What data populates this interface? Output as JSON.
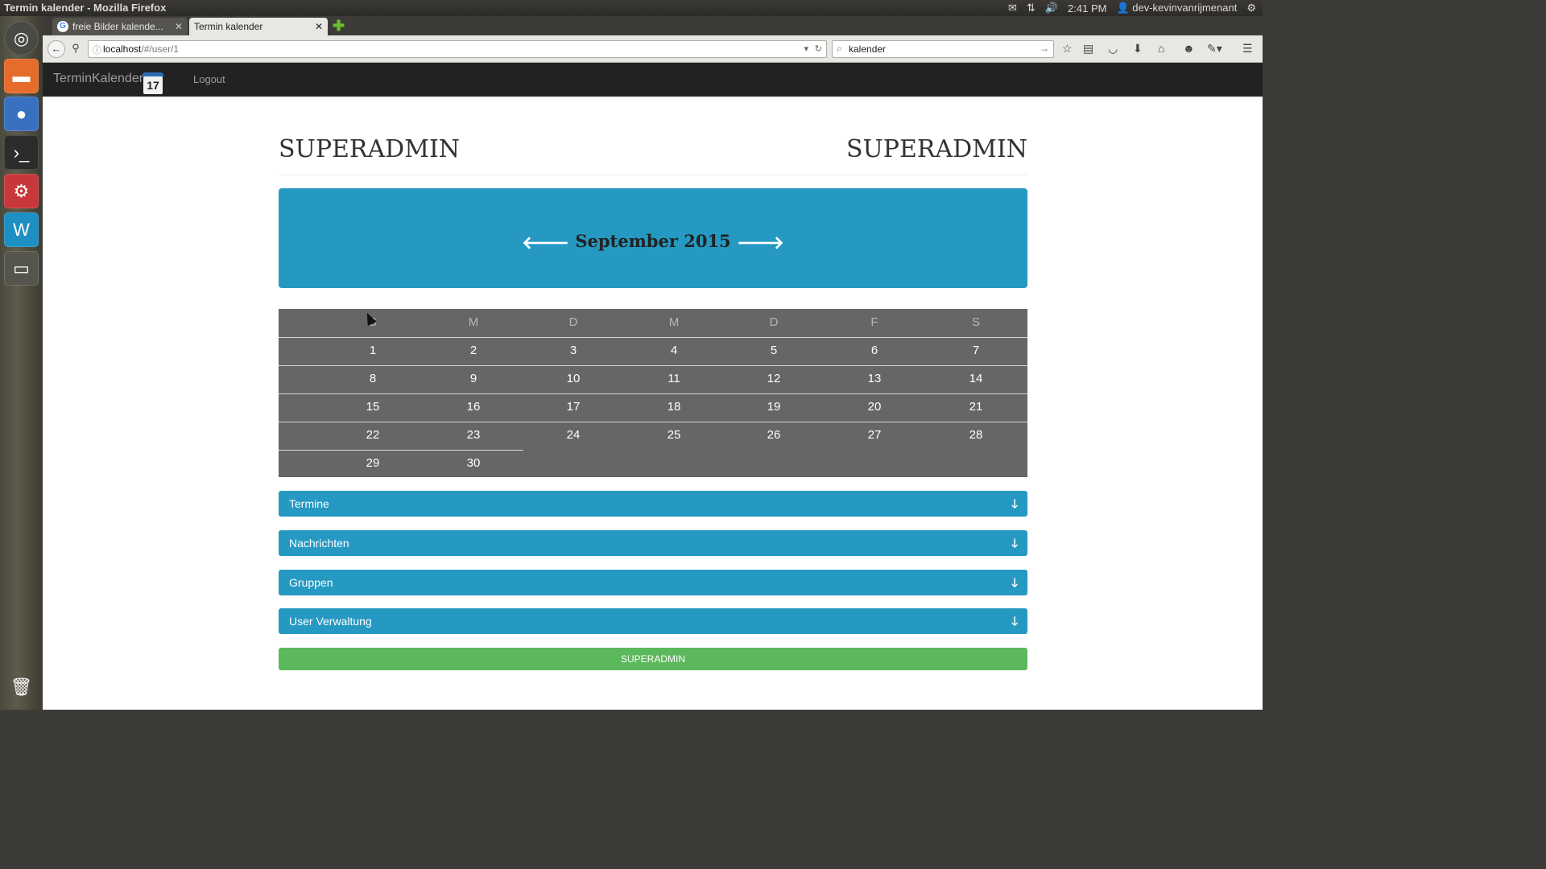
{
  "os_panel": {
    "window_title": "Termin kalender - Mozilla Firefox",
    "time": "2:41 PM",
    "user": "dev-kevinvanrijmenant"
  },
  "browser": {
    "tabs": [
      {
        "label": "freie Bilder kalende...",
        "active": false
      },
      {
        "label": "Termin kalender",
        "active": true
      }
    ],
    "url_host": "localhost",
    "url_path": "/#/user/1",
    "search_value": "kalender"
  },
  "app": {
    "brand": "TerminKalender",
    "brand_icon_day": "17",
    "logout_label": "Logout"
  },
  "header": {
    "left": "SUPERADMIN",
    "right": "SUPERADMIN"
  },
  "calendar": {
    "month_label": "September 2015",
    "weekdays": [
      "S",
      "M",
      "D",
      "M",
      "D",
      "F",
      "S"
    ],
    "weeks": [
      [
        "1",
        "2",
        "3",
        "4",
        "5",
        "6",
        "7"
      ],
      [
        "8",
        "9",
        "10",
        "11",
        "12",
        "13",
        "14"
      ],
      [
        "15",
        "16",
        "17",
        "18",
        "19",
        "20",
        "21"
      ],
      [
        "22",
        "23",
        "24",
        "25",
        "26",
        "27",
        "28"
      ],
      [
        "29",
        "30",
        "",
        "",
        "",
        "",
        ""
      ]
    ]
  },
  "panels": [
    {
      "label": "Termine"
    },
    {
      "label": "Nachrichten"
    },
    {
      "label": "Gruppen"
    },
    {
      "label": "User Verwaltung"
    }
  ],
  "footer_button": "SUPERADMIN",
  "colors": {
    "accent": "#2599c2",
    "calendar_bg": "#666666",
    "navbar_bg": "#222222",
    "success": "#5cb85c"
  }
}
